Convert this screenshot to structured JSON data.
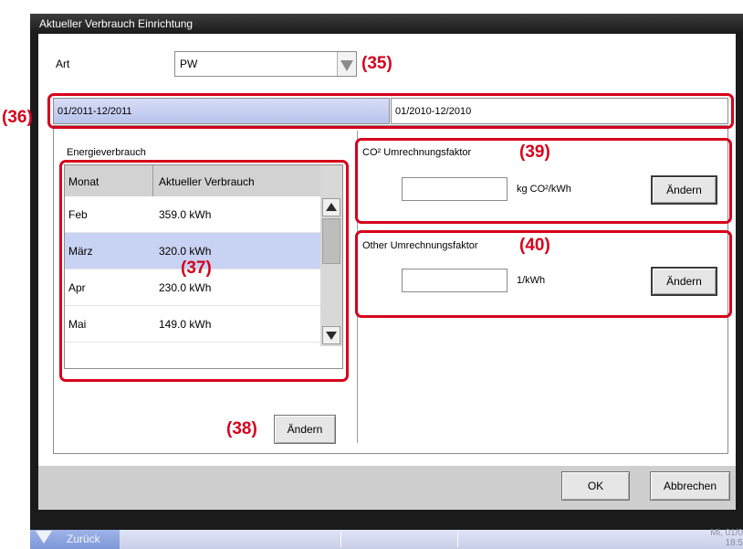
{
  "window": {
    "title": "Aktueller Verbrauch Einrichtung"
  },
  "art": {
    "label": "Art",
    "selected": "PW"
  },
  "period_tabs": [
    "01/2011-12/2011",
    "01/2010-12/2010"
  ],
  "energy": {
    "title": "Energieverbrauch",
    "columns": [
      "Monat",
      "Aktueller Verbrauch"
    ],
    "rows": [
      {
        "month": "Feb",
        "value": "359.0 kWh"
      },
      {
        "month": "März",
        "value": "320.0 kWh"
      },
      {
        "month": "Apr",
        "value": "230.0 kWh"
      },
      {
        "month": "Mai",
        "value": "149.0 kWh"
      }
    ],
    "selected_row": 1,
    "change_label": "Ändern"
  },
  "co2": {
    "label": "CO² Umrechnungsfaktor",
    "value": "",
    "unit": "kg CO²/kWh",
    "change_label": "Ändern"
  },
  "other": {
    "label": "Other Umrechnungsfaktor",
    "value": "",
    "unit": "1/kWh",
    "change_label": "Ändern"
  },
  "footer": {
    "ok": "OK",
    "cancel": "Abbrechen"
  },
  "taskbar": {
    "back_label": "Zurück",
    "clock_line1": "Mi, 01/0",
    "clock_line2": "18:5"
  },
  "callouts": {
    "c35": "(35)",
    "c36": "(36)",
    "c37": "(37)",
    "c38": "(38)",
    "c39": "(39)",
    "c40": "(40)"
  },
  "colors": {
    "callout_red": "#d6001c",
    "selected_row": "#c8d2f2",
    "active_tab": "#c5cef0"
  }
}
